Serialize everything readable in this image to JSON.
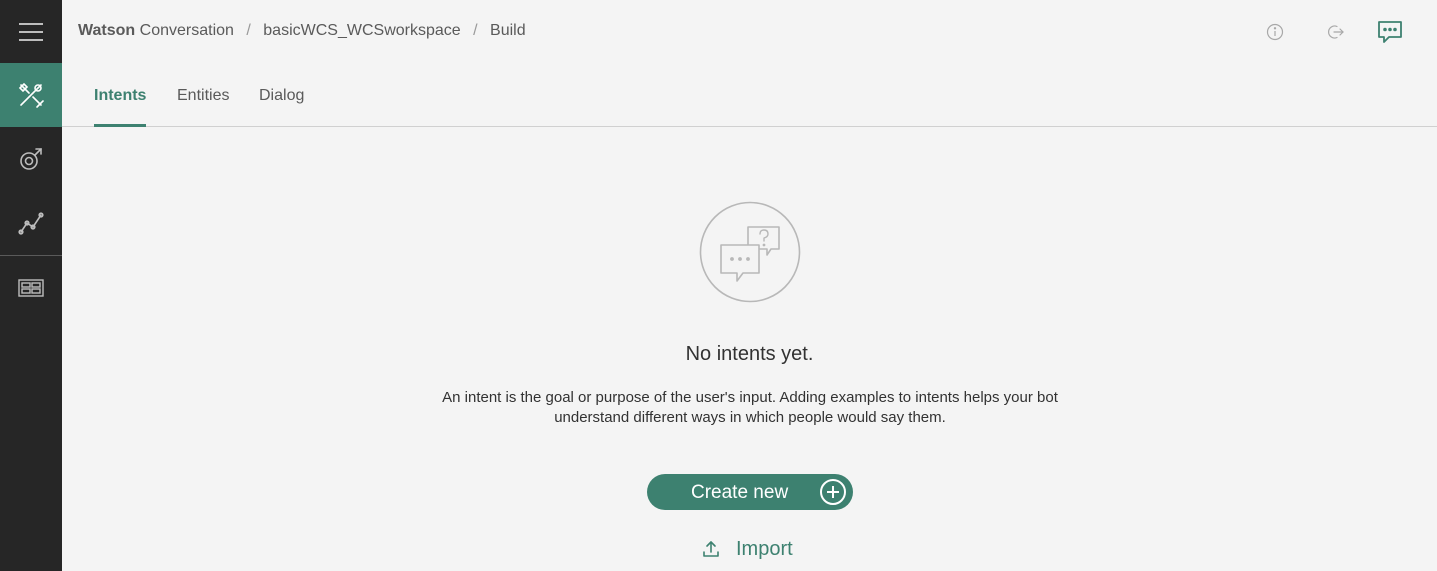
{
  "sidebar": {
    "items": [
      {
        "icon": "menu-icon"
      },
      {
        "icon": "build-tools-icon",
        "active": true
      },
      {
        "icon": "improve-icon"
      },
      {
        "icon": "analytics-icon"
      },
      {
        "icon": "workspaces-icon"
      }
    ]
  },
  "header": {
    "brand": "Watson",
    "product": "Conversation",
    "workspace": "basicWCS_WCSworkspace",
    "page": "Build",
    "icons": [
      "info-icon",
      "sign-out-icon",
      "chat-icon"
    ]
  },
  "tabs": [
    {
      "label": "Intents",
      "active": true
    },
    {
      "label": "Entities",
      "active": false
    },
    {
      "label": "Dialog",
      "active": false
    }
  ],
  "empty_state": {
    "icon": "chat-bubbles-question-icon",
    "title": "No intents yet.",
    "description": "An intent is the goal or purpose of the user's input. Adding examples to intents helps your bot understand different ways in which people would say them.",
    "create_label": "Create new",
    "import_label": "Import"
  },
  "colors": {
    "accent": "#3d8170",
    "sidebar_bg": "#262626",
    "page_bg": "#f4f4f4"
  }
}
